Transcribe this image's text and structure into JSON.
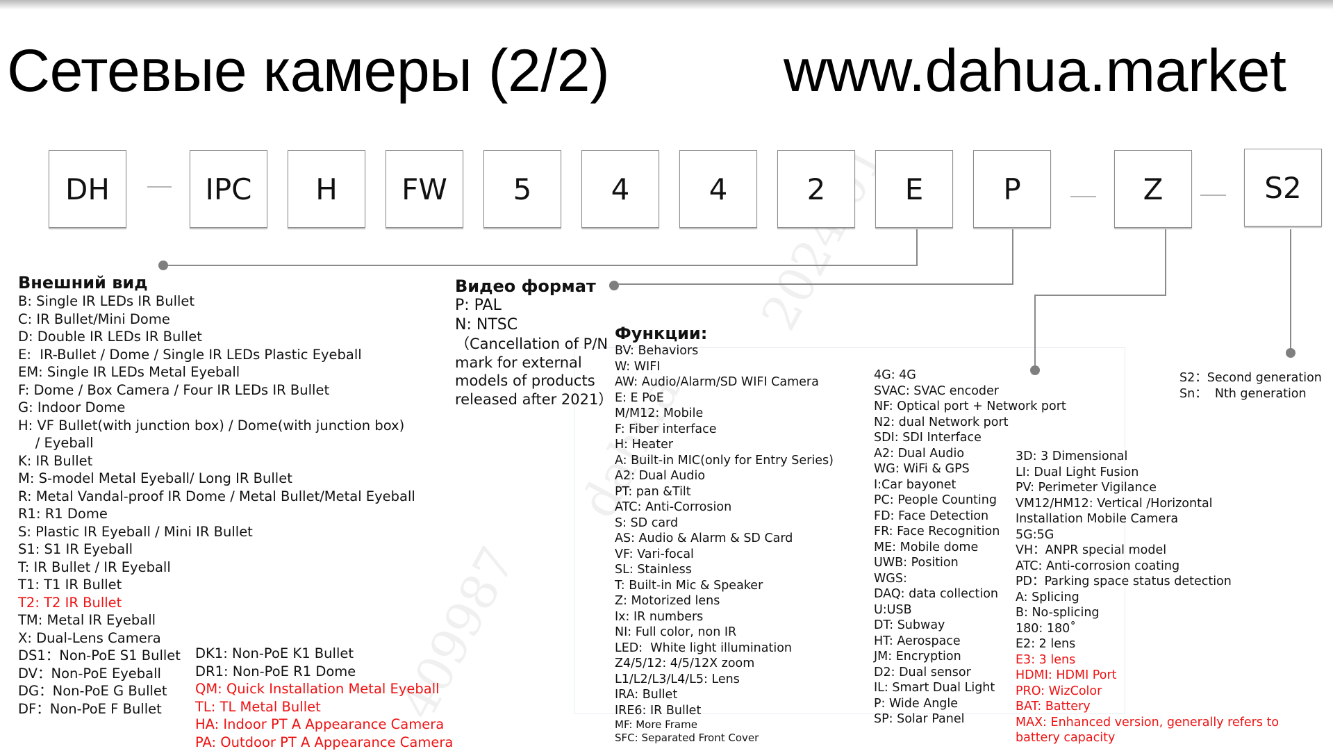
{
  "header": {
    "title": "Сетевые камеры (2/2)",
    "website": "www.dahua.market"
  },
  "model_code": {
    "segments": [
      "DH",
      "IPC",
      "H",
      "FW",
      "5",
      "4",
      "4",
      "2",
      "E",
      "P",
      "Z",
      "S2"
    ],
    "separator": "—"
  },
  "appearance": {
    "heading": "Внешний вид",
    "items": [
      {
        "text": "B: Single IR LEDs IR Bullet",
        "highlight": false
      },
      {
        "text": "C: IR Bullet/Mini Dome",
        "highlight": false
      },
      {
        "text": "D: Double IR LEDs IR Bullet",
        "highlight": false
      },
      {
        "text": "E:  IR-Bullet / Dome / Single IR LEDs Plastic Eyeball",
        "highlight": false
      },
      {
        "text": "EM: Single IR LEDs Metal Eyeball",
        "highlight": false
      },
      {
        "text": "F: Dome / Box Camera / Four IR LEDs IR Bullet",
        "highlight": false
      },
      {
        "text": "G: Indoor Dome",
        "highlight": false
      },
      {
        "text": "H: VF Bullet(with junction box) / Dome(with junction box)",
        "highlight": false
      },
      {
        "text": "    / Eyeball",
        "highlight": false
      },
      {
        "text": "K: IR Bullet",
        "highlight": false
      },
      {
        "text": "M: S-model Metal Eyeball/ Long IR Bullet",
        "highlight": false
      },
      {
        "text": "R: Metal Vandal-proof IR Dome / Metal Bullet/Metal Eyeball",
        "highlight": false
      },
      {
        "text": "R1: R1 Dome",
        "highlight": false
      },
      {
        "text": "S: Plastic IR Eyeball / Mini IR Bullet",
        "highlight": false
      },
      {
        "text": "S1: S1 IR Eyeball",
        "highlight": false
      },
      {
        "text": "T: IR Bullet / IR Eyeball",
        "highlight": false
      },
      {
        "text": "T1: T1 IR Bullet",
        "highlight": false
      },
      {
        "text": "T2: T2 IR Bullet",
        "highlight": true
      },
      {
        "text": "TM: Metal IR Eyeball",
        "highlight": false
      },
      {
        "text": "X: Dual-Lens Camera",
        "highlight": false
      },
      {
        "text": "DS1：Non-PoE S1 Bullet",
        "highlight": false
      },
      {
        "text": "DV：Non-PoE Eyeball",
        "highlight": false
      },
      {
        "text": "DG：Non-PoE G Bullet",
        "highlight": false
      },
      {
        "text": "DF：Non-PoE F Bullet",
        "highlight": false
      }
    ],
    "items_col2": [
      {
        "text": "DK1: Non-PoE K1 Bullet",
        "highlight": false
      },
      {
        "text": "DR1: Non-PoE R1 Dome",
        "highlight": false
      },
      {
        "text": "QM: Quick Installation Metal Eyeball",
        "highlight": true
      },
      {
        "text": "TL: TL Metal Bullet",
        "highlight": true
      },
      {
        "text": "HA: Indoor PT A Appearance Camera",
        "highlight": true
      },
      {
        "text": "PA: Outdoor PT A Appearance Camera",
        "highlight": true
      }
    ]
  },
  "video_format": {
    "heading": "Видео формат",
    "items": [
      "P: PAL",
      "N: NTSC"
    ],
    "note": [
      "（Cancellation of P/N",
      "mark for external",
      "models of products",
      "released after 2021）"
    ]
  },
  "functions": {
    "heading": "Функции:",
    "col1": [
      "BV: Behaviors",
      "W: WIFI",
      "AW: Audio/Alarm/SD WIFI Camera",
      "E: E PoE",
      "M/M12: Mobile",
      "F: Fiber interface",
      "H: Heater",
      "A: Built-in MIC(only for Entry Series)",
      "A2: Dual Audio",
      "PT: pan &Tilt",
      "ATC: Anti-Corrosion",
      "S: SD card",
      "AS: Audio & Alarm & SD Card",
      "VF: Vari-focal",
      "SL: Stainless",
      "T: Built-in Mic & Speaker",
      "Z: Motorized lens",
      "Ix: IR numbers",
      "NI: Full color, non IR",
      "LED:  White light illumination",
      "Z4/5/12: 4/5/12X zoom",
      "L1/L2/L3/L4/L5: Lens",
      "IRA: Bullet",
      "IRE6: IR Bullet"
    ],
    "col1_small": [
      "MF: More Frame",
      "SFC: Separated Front Cover"
    ],
    "col2": [
      "4G: 4G",
      "SVAC: SVAC encoder",
      "NF: Optical port + Network port",
      "N2: dual Network port",
      "SDI: SDI Interface",
      "A2: Dual Audio",
      "WG: WiFi & GPS",
      "I:Car bayonet",
      "PC: People Counting",
      "FD: Face Detection",
      "FR: Face Recognition",
      "ME: Mobile dome",
      "UWB: Position",
      "WGS:",
      "DAQ: data collection",
      "U:USB",
      "DT: Subway",
      "HT: Aerospace",
      "JM: Encryption",
      "D2: Dual sensor",
      "IL: Smart Dual Light",
      "P: Wide Angle",
      "SP: Solar Panel"
    ],
    "col3": [
      {
        "text": "3D: 3 Dimensional",
        "highlight": false
      },
      {
        "text": "LI: Dual Light Fusion",
        "highlight": false
      },
      {
        "text": "PV: Perimeter Vigilance",
        "highlight": false
      },
      {
        "text": "VM12/HM12: Vertical /Horizontal",
        "highlight": false
      },
      {
        "text": "Installation Mobile Camera",
        "highlight": false
      },
      {
        "text": "5G:5G",
        "highlight": false
      },
      {
        "text": "VH：ANPR special model",
        "highlight": false
      },
      {
        "text": "ATC: Anti-corrosion coating",
        "highlight": false
      },
      {
        "text": "PD：Parking space status detection",
        "highlight": false
      },
      {
        "text": "A: Splicing",
        "highlight": false
      },
      {
        "text": "B: No-splicing",
        "highlight": false
      },
      {
        "text": "180: 180˚",
        "highlight": false
      },
      {
        "text": "E2: 2 lens",
        "highlight": false
      },
      {
        "text": "E3: 3 lens",
        "highlight": true
      },
      {
        "text": "HDMI: HDMI Port",
        "highlight": true
      },
      {
        "text": "PRO: WizColor",
        "highlight": true
      },
      {
        "text": "BAT: Battery",
        "highlight": true
      },
      {
        "text": "MAX: Enhanced version, generally refers to",
        "highlight": true
      },
      {
        "text": "battery capacity",
        "highlight": true
      }
    ]
  },
  "generation": {
    "items": [
      "S2：Second generation",
      "Sn：  Nth generation"
    ]
  },
  "colors": {
    "highlight": "#ee1111",
    "connector": "#8a8a8a",
    "dot": "#7f7f7f"
  },
  "watermark": {
    "text": [
      "409987",
      "dahua",
      "2024-01"
    ]
  }
}
